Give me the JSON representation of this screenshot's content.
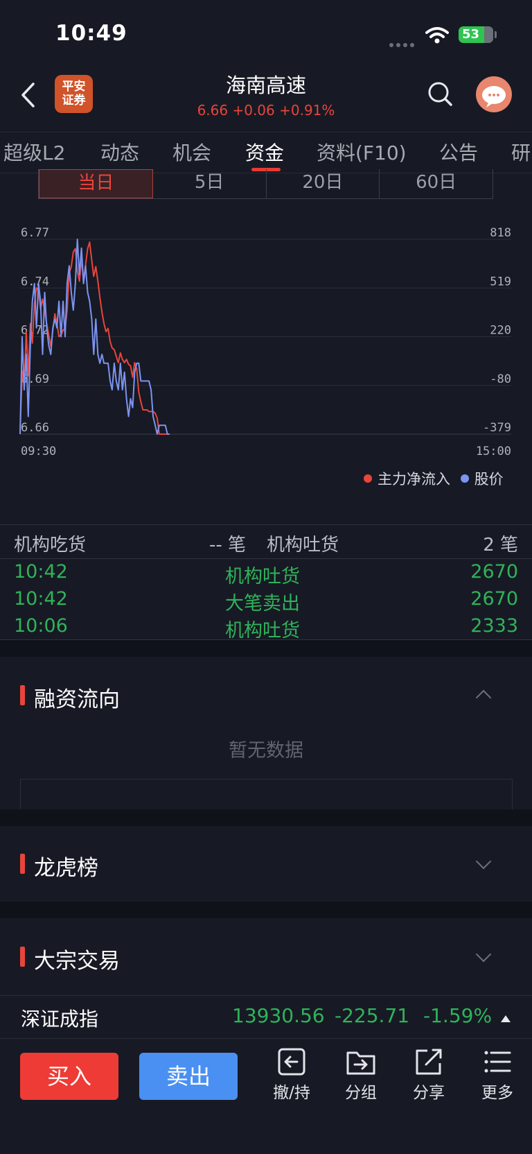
{
  "status_bar": {
    "time": "10:49",
    "battery": "53"
  },
  "header": {
    "logo_text_line1": "平安",
    "logo_text_line2": "证券",
    "stock_name": "海南高速",
    "quote": "6.66 +0.06 +0.91%",
    "colors": {
      "up": "#e8453c",
      "down": "#2fb35a",
      "accent": "#e83a32"
    }
  },
  "tabs": [
    {
      "label": "超级L2"
    },
    {
      "label": "动态"
    },
    {
      "label": "机会"
    },
    {
      "label": "资金",
      "active": true
    },
    {
      "label": "资料(F10)"
    },
    {
      "label": "公告"
    },
    {
      "label": "研"
    }
  ],
  "period_tabs": [
    {
      "label": "当日",
      "active": true
    },
    {
      "label": "5日"
    },
    {
      "label": "20日"
    },
    {
      "label": "60日"
    }
  ],
  "chart_data": {
    "type": "line",
    "left_axis_ticks": [
      "6.77",
      "6.74",
      "6.72",
      "6.69",
      "6.66"
    ],
    "left_ylim": [
      6.66,
      6.77
    ],
    "right_axis_ticks": [
      "818",
      "519",
      "220",
      "-80",
      "-379"
    ],
    "right_ylim": [
      -379,
      818
    ],
    "x_start_label": "09:30",
    "x_end_label": "15:00",
    "x_range_minutes": [
      0,
      240
    ],
    "grid": true,
    "legend_position": "bottom-right",
    "series": [
      {
        "name": "主力净流入",
        "color": "#e8453c",
        "axis": "right",
        "points": [
          [
            0,
            -379
          ],
          [
            1,
            10
          ],
          [
            2,
            -80
          ],
          [
            3,
            250
          ],
          [
            4,
            -20
          ],
          [
            5,
            300
          ],
          [
            6,
            180
          ],
          [
            7,
            420
          ],
          [
            8,
            520
          ],
          [
            9,
            500
          ],
          [
            10,
            390
          ],
          [
            11,
            450
          ],
          [
            12,
            380
          ],
          [
            13,
            300
          ],
          [
            14,
            230
          ],
          [
            15,
            160
          ],
          [
            16,
            260
          ],
          [
            17,
            360
          ],
          [
            18,
            300
          ],
          [
            19,
            220
          ],
          [
            20,
            230
          ],
          [
            21,
            260
          ],
          [
            22,
            270
          ],
          [
            23,
            380
          ],
          [
            24,
            610
          ],
          [
            25,
            650
          ],
          [
            26,
            740
          ],
          [
            27,
            760
          ],
          [
            28,
            620
          ],
          [
            29,
            560
          ],
          [
            30,
            700
          ],
          [
            31,
            560
          ],
          [
            32,
            660
          ],
          [
            33,
            760
          ],
          [
            34,
            800
          ],
          [
            35,
            690
          ],
          [
            36,
            590
          ],
          [
            37,
            650
          ],
          [
            38,
            560
          ],
          [
            39,
            460
          ],
          [
            40,
            370
          ],
          [
            41,
            300
          ],
          [
            42,
            250
          ],
          [
            43,
            270
          ],
          [
            44,
            190
          ],
          [
            45,
            150
          ],
          [
            46,
            140
          ],
          [
            47,
            100
          ],
          [
            48,
            60
          ],
          [
            49,
            120
          ],
          [
            50,
            80
          ],
          [
            51,
            60
          ],
          [
            52,
            80
          ],
          [
            53,
            50
          ],
          [
            54,
            40
          ],
          [
            55,
            -30
          ],
          [
            56,
            60
          ],
          [
            57,
            20
          ],
          [
            58,
            -120
          ],
          [
            59,
            -180
          ],
          [
            60,
            -230
          ],
          [
            61,
            -230
          ],
          [
            62,
            -230
          ],
          [
            63,
            -240
          ],
          [
            64,
            -240
          ],
          [
            65,
            -240
          ],
          [
            66,
            -250
          ],
          [
            67,
            -280
          ],
          [
            68,
            -379
          ],
          [
            69,
            -379
          ],
          [
            70,
            -379
          ],
          [
            71,
            -379
          ],
          [
            72,
            -379
          ],
          [
            73,
            -379
          ]
        ]
      },
      {
        "name": "股价",
        "color": "#7b94f2",
        "axis": "left",
        "points": [
          [
            0,
            6.66
          ],
          [
            1,
            6.715
          ],
          [
            2,
            6.685
          ],
          [
            3,
            6.705
          ],
          [
            4,
            6.67
          ],
          [
            5,
            6.71
          ],
          [
            6,
            6.735
          ],
          [
            7,
            6.745
          ],
          [
            8,
            6.72
          ],
          [
            9,
            6.745
          ],
          [
            10,
            6.735
          ],
          [
            11,
            6.705
          ],
          [
            12,
            6.74
          ],
          [
            13,
            6.72
          ],
          [
            14,
            6.71
          ],
          [
            15,
            6.705
          ],
          [
            16,
            6.72
          ],
          [
            17,
            6.725
          ],
          [
            18,
            6.72
          ],
          [
            19,
            6.735
          ],
          [
            20,
            6.715
          ],
          [
            21,
            6.735
          ],
          [
            22,
            6.715
          ],
          [
            23,
            6.745
          ],
          [
            24,
            6.755
          ],
          [
            25,
            6.74
          ],
          [
            26,
            6.73
          ],
          [
            27,
            6.745
          ],
          [
            28,
            6.77
          ],
          [
            29,
            6.75
          ],
          [
            30,
            6.765
          ],
          [
            31,
            6.745
          ],
          [
            32,
            6.755
          ],
          [
            33,
            6.74
          ],
          [
            34,
            6.735
          ],
          [
            35,
            6.725
          ],
          [
            36,
            6.705
          ],
          [
            37,
            6.725
          ],
          [
            38,
            6.705
          ],
          [
            39,
            6.7
          ],
          [
            40,
            6.705
          ],
          [
            41,
            6.7
          ],
          [
            42,
            6.7
          ],
          [
            43,
            6.7
          ],
          [
            44,
            6.69
          ],
          [
            45,
            6.685
          ],
          [
            46,
            6.7
          ],
          [
            47,
            6.69
          ],
          [
            48,
            6.685
          ],
          [
            49,
            6.7
          ],
          [
            50,
            6.685
          ],
          [
            51,
            6.695
          ],
          [
            52,
            6.68
          ],
          [
            53,
            6.67
          ],
          [
            54,
            6.68
          ],
          [
            55,
            6.675
          ],
          [
            56,
            6.695
          ],
          [
            57,
            6.7
          ],
          [
            58,
            6.7
          ],
          [
            59,
            6.69
          ],
          [
            60,
            6.69
          ],
          [
            61,
            6.69
          ],
          [
            62,
            6.69
          ],
          [
            63,
            6.69
          ],
          [
            64,
            6.685
          ],
          [
            65,
            6.67
          ],
          [
            66,
            6.665
          ],
          [
            67,
            6.66
          ],
          [
            68,
            6.665
          ],
          [
            69,
            6.665
          ],
          [
            70,
            6.665
          ],
          [
            71,
            6.665
          ],
          [
            72,
            6.66
          ],
          [
            73,
            6.66
          ]
        ]
      }
    ]
  },
  "institutional": {
    "buy_label": "机构吃货",
    "buy_count": "-- 笔",
    "sell_label": "机构吐货",
    "sell_count": "2 笔",
    "rows": [
      {
        "time": "10:42",
        "type": "机构吐货",
        "volume": "2670"
      },
      {
        "time": "10:42",
        "type": "大笔卖出",
        "volume": "2670"
      },
      {
        "time": "10:06",
        "type": "机构吐货",
        "volume": "2333"
      }
    ]
  },
  "sections": {
    "margin": {
      "title": "融资流向",
      "empty_text": "暂无数据"
    },
    "dragon_tiger": {
      "title": "龙虎榜"
    },
    "block_trade": {
      "title": "大宗交易"
    }
  },
  "index_bar": {
    "name": "深证成指",
    "value": "13930.56",
    "change": "-225.71",
    "change_pct": "-1.59%"
  },
  "toolbar": {
    "buy": "买入",
    "sell": "卖出",
    "cancel_hold": "撤/持",
    "group": "分组",
    "share": "分享",
    "more": "更多"
  }
}
